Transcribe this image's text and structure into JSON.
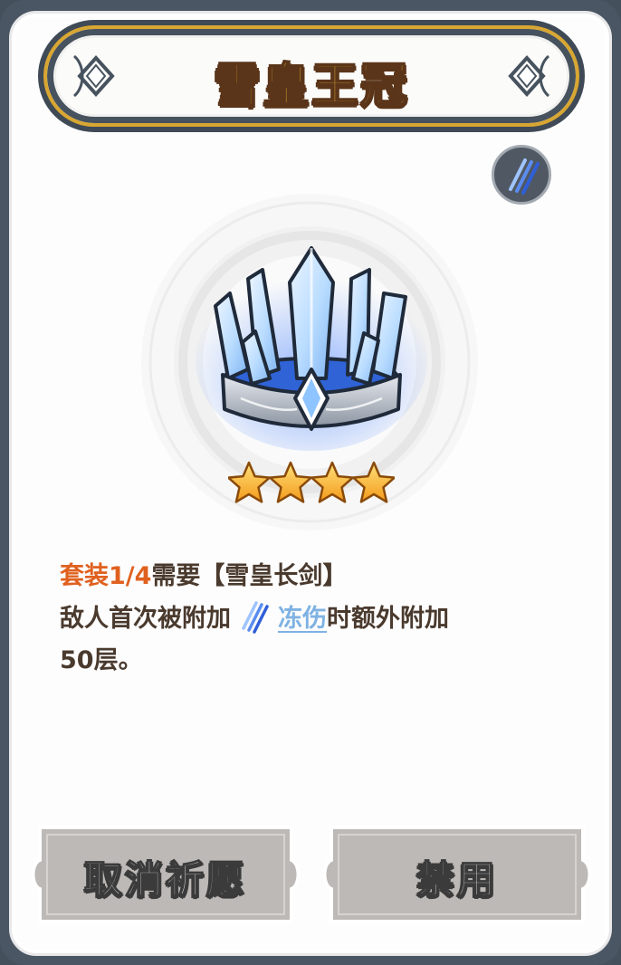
{
  "item": {
    "title": "雪皇王冠",
    "stars": 4,
    "icon": "ice-crown-icon",
    "badge_icon": "frostbite-claw-icon"
  },
  "description": {
    "set_label": "套装1/4",
    "requirement": "需要【雪皇长剑】",
    "line2_prefix": "敌人首次被附加",
    "status_icon": "frostbite-claw-icon",
    "keyword": "冻伤",
    "line2_suffix": "时额外附加",
    "line3": "50层。"
  },
  "buttons": {
    "cancel_label": "取消祈愿",
    "ban_label": "禁用"
  },
  "colors": {
    "title_fill": "#f6b33a",
    "title_outline": "#5a3519",
    "banner_border": "#d8a632",
    "set_text": "#e0611f",
    "body_text": "#4a3a2e",
    "keyword_link": "#7fb2e3",
    "button_fill": "#bdb9b6",
    "frame": "#4a5663"
  }
}
